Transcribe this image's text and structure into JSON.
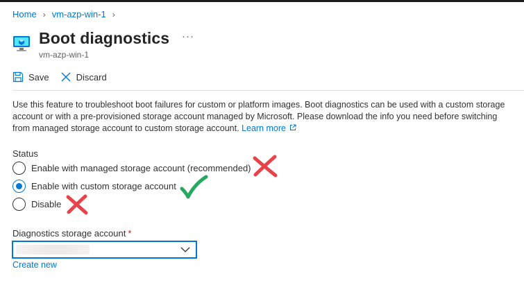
{
  "breadcrumb": {
    "items": [
      "Home",
      "vm-azp-win-1"
    ],
    "separator": ">"
  },
  "header": {
    "title": "Boot diagnostics",
    "subtitle": "vm-azp-win-1",
    "more_label": "···",
    "icon": "virtual-machine-icon"
  },
  "toolbar": {
    "save_label": "Save",
    "discard_label": "Discard"
  },
  "description": {
    "text": "Use this feature to troubleshoot boot failures for custom or platform images. Boot diagnostics can be used with a custom storage account or with a pre-provisioned storage account managed by Microsoft. Please download the info you need before switching from managed storage account to custom storage account.",
    "link_label": "Learn more"
  },
  "status": {
    "label": "Status",
    "options": [
      {
        "label": "Enable with managed storage account (recommended)",
        "checked": false,
        "annotation": "red-x"
      },
      {
        "label": "Enable with custom storage account",
        "checked": true,
        "annotation": "green-check"
      },
      {
        "label": "Disable",
        "checked": false,
        "annotation": "red-x"
      }
    ]
  },
  "storage": {
    "label": "Diagnostics storage account",
    "required_marker": "*",
    "selected_value": "",
    "create_link": "Create new"
  },
  "colors": {
    "accent": "#0078d4",
    "text": "#323130",
    "required": "#a4262c",
    "annotation_red": "#e8434a",
    "annotation_green": "#27a85f"
  }
}
